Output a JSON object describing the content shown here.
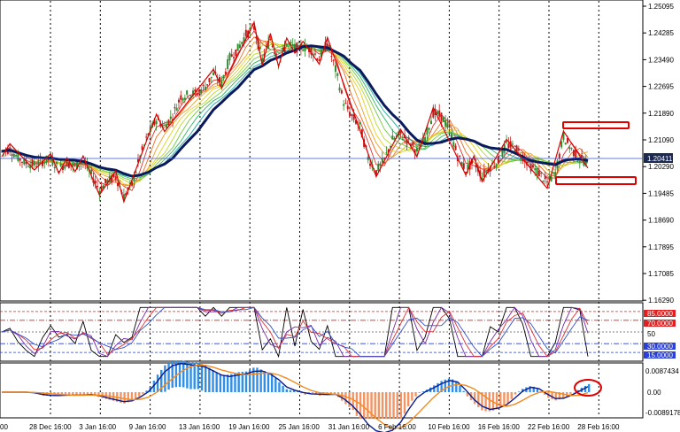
{
  "price_panel": {
    "y_labels": [
      "1.25095",
      "1.24285",
      "1.23490",
      "1.22695",
      "1.21890",
      "1.21090",
      "1.20290",
      "1.19485",
      "1.18690",
      "1.17895",
      "1.17085",
      "1.16290"
    ],
    "current_price": "1.20411"
  },
  "rsi_panel": {
    "levels": {
      "high": "85.0000",
      "mid_high": "70.0000",
      "mid": "50",
      "mid_low": "30.0000",
      "low": "15.0000"
    }
  },
  "macd_panel": {
    "labels": {
      "top": "0.0087434",
      "zero": "0.00",
      "bottom": "-0.0089178"
    }
  },
  "time_axis": {
    "labels": [
      "00",
      "28 Dec 16:00",
      "3 Jan 16:00",
      "9 Jan 16:00",
      "13 Jan 16:00",
      "19 Jan 16:00",
      "25 Jan 16:00",
      "31 Jan 16:00",
      "6 Feb 16:00",
      "10 Feb 16:00",
      "16 Feb 16:00",
      "22 Feb 16:00",
      "28 Feb 16:00"
    ]
  },
  "colors": {
    "main_ma": "#0a1a5c",
    "zigzag": "#dd0000",
    "hist_pos": "#2f8fe8",
    "hist_neg": "#f29463",
    "price_tag_bg": "#1c2a52",
    "rsi_red_tag": "#e02020",
    "rsi_blue_tag": "#2a3fd6"
  },
  "chart_data": {
    "type": "line",
    "title": "",
    "series": [
      {
        "values": [
          1.2075,
          1.2082,
          1.2056,
          1.204,
          1.2035,
          1.2045,
          1.2052,
          1.2025,
          1.204,
          1.203,
          1.2045,
          1.2005,
          1.196,
          1.1985,
          1.2,
          1.194,
          1.1975,
          1.206,
          1.2125,
          1.217,
          1.215,
          1.2182,
          1.224,
          1.2245,
          1.225,
          1.227,
          1.2305,
          1.228,
          1.2355,
          1.2382,
          1.2425,
          1.2445,
          1.2348,
          1.2412,
          1.2345,
          1.2398,
          1.2385,
          1.2388,
          1.238,
          1.2352,
          1.24,
          1.232,
          1.2222,
          1.218,
          1.215,
          1.2055,
          1.2015,
          1.205,
          1.211,
          1.2125,
          1.2105,
          1.2075,
          1.2115,
          1.219,
          1.218,
          1.214,
          1.206,
          1.202,
          1.2045,
          1.2,
          1.203,
          1.2045,
          1.2095,
          1.2088,
          1.206,
          1.203,
          1.201,
          1.198,
          1.201,
          1.212,
          1.208,
          1.2052,
          1.2041
        ]
      }
    ]
  }
}
